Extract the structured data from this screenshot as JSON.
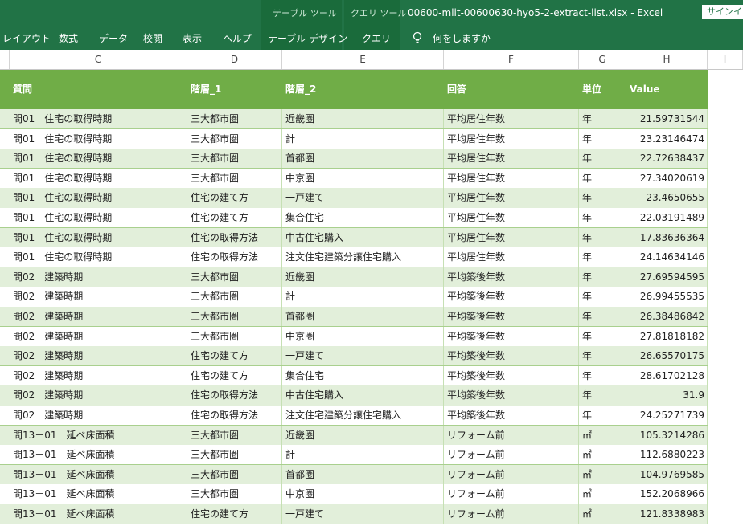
{
  "ribbon": {
    "context_table": "テーブル ツール",
    "context_query": "クエリ ツール",
    "title": "00600-mlit-00600630-hyo5-2-extract-list.xlsx  -  Excel",
    "signin": "サインイン",
    "tabs": [
      "レイアウト",
      "数式",
      "データ",
      "校閲",
      "表示",
      "ヘルプ",
      "テーブル デザイン",
      "クエリ"
    ],
    "tell_me": "何をしますか"
  },
  "columns": [
    "C",
    "D",
    "E",
    "F",
    "G",
    "H",
    "I"
  ],
  "table": {
    "headers": [
      "質問",
      "階層_1",
      "階層_2",
      "回答",
      "単位",
      "Value"
    ],
    "rows": [
      [
        "問01　住宅の取得時期",
        "三大都市圏",
        "近畿圏",
        "平均居住年数",
        "年",
        "21.59731544"
      ],
      [
        "問01　住宅の取得時期",
        "三大都市圏",
        "計",
        "平均居住年数",
        "年",
        "23.23146474"
      ],
      [
        "問01　住宅の取得時期",
        "三大都市圏",
        "首都圏",
        "平均居住年数",
        "年",
        "22.72638437"
      ],
      [
        "問01　住宅の取得時期",
        "三大都市圏",
        "中京圏",
        "平均居住年数",
        "年",
        "27.34020619"
      ],
      [
        "問01　住宅の取得時期",
        "住宅の建て方",
        "一戸建て",
        "平均居住年数",
        "年",
        "23.4650655"
      ],
      [
        "問01　住宅の取得時期",
        "住宅の建て方",
        "集合住宅",
        "平均居住年数",
        "年",
        "22.03191489"
      ],
      [
        "問01　住宅の取得時期",
        "住宅の取得方法",
        "中古住宅購入",
        "平均居住年数",
        "年",
        "17.83636364"
      ],
      [
        "問01　住宅の取得時期",
        "住宅の取得方法",
        "注文住宅建築分譲住宅購入",
        "平均居住年数",
        "年",
        "24.14634146"
      ],
      [
        "問02　建築時期",
        "三大都市圏",
        "近畿圏",
        "平均築後年数",
        "年",
        "27.69594595"
      ],
      [
        "問02　建築時期",
        "三大都市圏",
        "計",
        "平均築後年数",
        "年",
        "26.99455535"
      ],
      [
        "問02　建築時期",
        "三大都市圏",
        "首都圏",
        "平均築後年数",
        "年",
        "26.38486842"
      ],
      [
        "問02　建築時期",
        "三大都市圏",
        "中京圏",
        "平均築後年数",
        "年",
        "27.81818182"
      ],
      [
        "問02　建築時期",
        "住宅の建て方",
        "一戸建て",
        "平均築後年数",
        "年",
        "26.65570175"
      ],
      [
        "問02　建築時期",
        "住宅の建て方",
        "集合住宅",
        "平均築後年数",
        "年",
        "28.61702128"
      ],
      [
        "問02　建築時期",
        "住宅の取得方法",
        "中古住宅購入",
        "平均築後年数",
        "年",
        "31.9"
      ],
      [
        "問02　建築時期",
        "住宅の取得方法",
        "注文住宅建築分譲住宅購入",
        "平均築後年数",
        "年",
        "24.25271739"
      ],
      [
        "問13－01　延べ床面積",
        "三大都市圏",
        "近畿圏",
        "リフォーム前",
        "㎡",
        "105.3214286"
      ],
      [
        "問13－01　延べ床面積",
        "三大都市圏",
        "計",
        "リフォーム前",
        "㎡",
        "112.6880223"
      ],
      [
        "問13－01　延べ床面積",
        "三大都市圏",
        "首都圏",
        "リフォーム前",
        "㎡",
        "104.9769585"
      ],
      [
        "問13－01　延べ床面積",
        "三大都市圏",
        "中京圏",
        "リフォーム前",
        "㎡",
        "152.2068966"
      ],
      [
        "問13－01　延べ床面積",
        "住宅の建て方",
        "一戸建て",
        "リフォーム前",
        "㎡",
        "121.8338983"
      ]
    ]
  }
}
